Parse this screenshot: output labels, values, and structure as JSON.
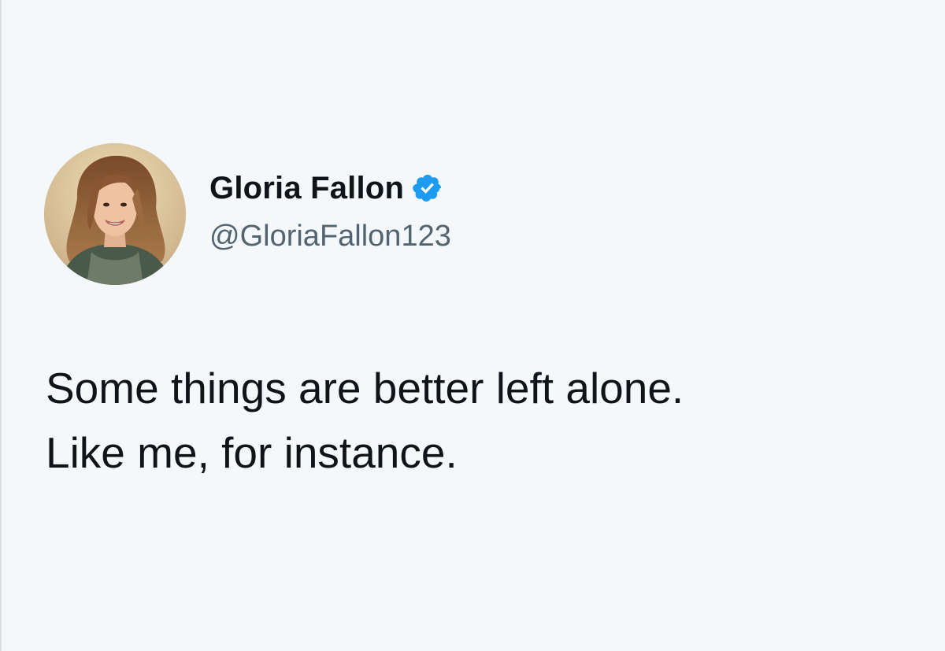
{
  "tweet": {
    "author": {
      "display_name": "Gloria Fallon",
      "handle": "@GloriaFallon123",
      "verified": true,
      "verified_icon": "verified-badge-icon",
      "verified_color": "#1d9bf0"
    },
    "text_lines": [
      "Some things are better left alone.",
      "Like me, for instance."
    ]
  },
  "colors": {
    "background": "#f4f8fb",
    "primary_text": "#0f1419",
    "secondary_text": "#536471"
  }
}
